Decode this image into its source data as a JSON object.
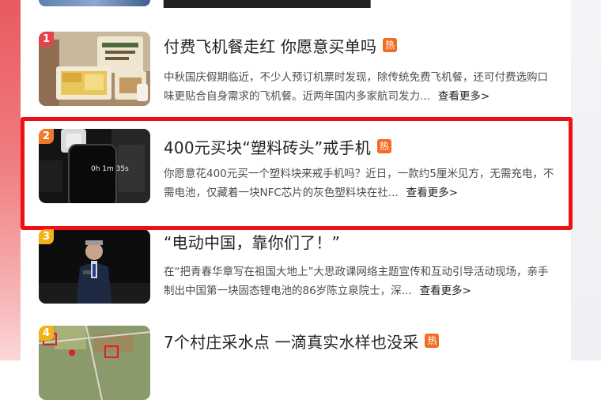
{
  "news": [
    {
      "rank": "1",
      "rank_color": "#e8434a",
      "title": "付费飞机餐走红 你愿意买单吗",
      "hot_label": "热",
      "summary": "中秋国庆假期临近，不少人预订机票时发现，除传统免费飞机餐，还可付费选购口味更贴合自身需求的飞机餐。近两年国内多家航司发力...",
      "more": "查看更多>",
      "thumb_icon": "boxed-meal-photo"
    },
    {
      "rank": "2",
      "rank_color": "#f07a2a",
      "title": "400元买块“塑料砖头”戒手机",
      "hot_label": "热",
      "summary": "你愿意花400元买一个塑料块来戒手机吗？近日，一款约5厘米见方，无需充电，不需电池，仅藏着一块NFC芯片的灰色塑料块在社...",
      "more": "查看更多>",
      "thumb_icon": "phone-timer-photo",
      "thumb_text": "0h 1m 35s"
    },
    {
      "rank": "3",
      "rank_color": "#f2b21c",
      "title": "“电动中国，靠你们了！”",
      "summary": "在“把青春华章写在祖国大地上”大思政课网络主题宣传和互动引导活动现场，亲手制出中国第一块固态锂电池的86岁陈立泉院士，深...",
      "more": "查看更多>",
      "thumb_icon": "speaker-on-stage-photo"
    },
    {
      "rank": "4",
      "rank_color": "#f2b21c",
      "title": "7个村庄采水点 一滴真实水样也没采",
      "hot_label": "热",
      "thumb_icon": "satellite-map-photo"
    }
  ]
}
